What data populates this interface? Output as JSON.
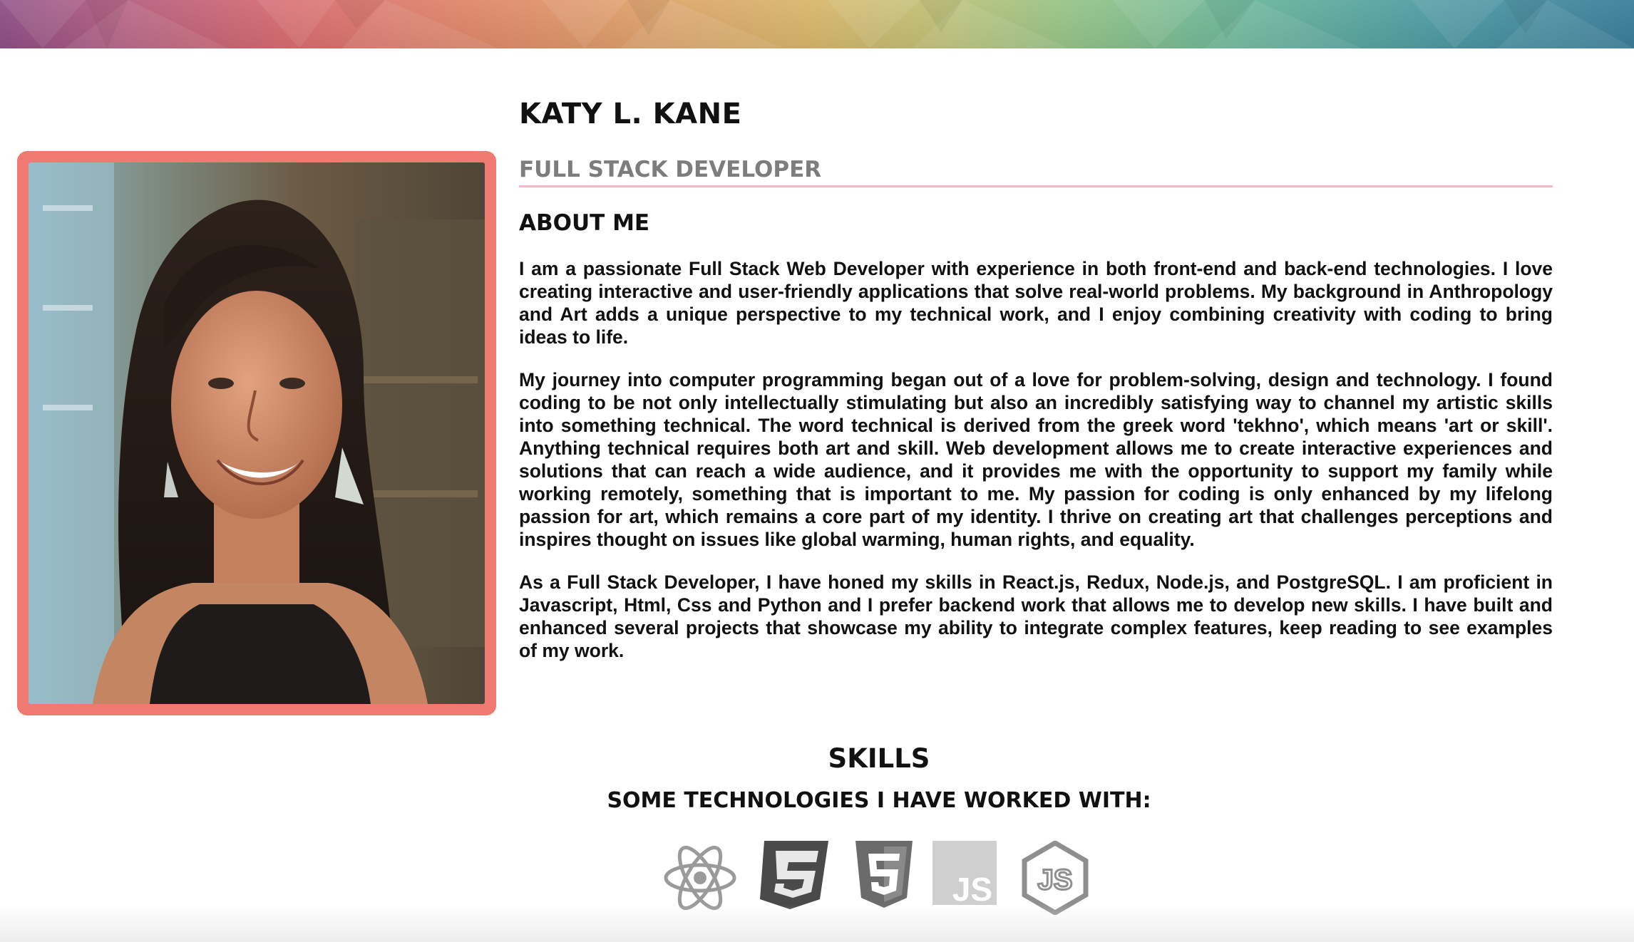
{
  "colors": {
    "frame": "#f07a72",
    "role_underline": "#f4b7c3",
    "role_text": "#7d7d7d",
    "icon_gray": "#8c8c8c"
  },
  "profile": {
    "name": "KATY L. KANE",
    "role": "FULL STACK DEVELOPER",
    "photo_alt": "Katy L. Kane"
  },
  "about": {
    "title": "ABOUT ME",
    "paragraphs": [
      "I am a passionate Full Stack Web Developer with experience in both front-end and back-end technologies. I love creating interactive and user-friendly applications that solve real-world problems. My background in Anthropology and Art adds a unique perspective to my technical work, and I enjoy combining creativity with coding to bring ideas to life.",
      "My journey into computer programming began out of a love for problem-solving, design and technology. I found coding to be not only intellectually stimulating but also an incredibly satisfying way to channel my artistic skills into something technical. The word technical is derived from the greek word 'tekhno', which means 'art or skill'. Anything technical requires both art and skill. Web development allows me to create interactive experiences and solutions that can reach a wide audience, and it provides me with the opportunity to support my family while working remotely, something that is important to me. My passion for coding is only enhanced by my lifelong passion for art, which remains a core part of my identity. I thrive on creating art that challenges perceptions and inspires thought on issues like global warming, human rights, and equality.",
      "As a Full Stack Developer, I have honed my skills in React.js, Redux, Node.js, and PostgreSQL. I am proficient in Javascript, Html, Css and Python and I prefer backend work that allows me to develop new skills. I have built and enhanced several projects that showcase my ability to integrate complex features, keep reading to see examples of my work."
    ]
  },
  "skills": {
    "title": "SKILLS",
    "subtitle": "SOME TECHNOLOGIES I HAVE WORKED WITH:",
    "technologies": [
      {
        "icon": "react-icon"
      },
      {
        "icon": "css3-icon"
      },
      {
        "icon": "html5-icon"
      },
      {
        "icon": "javascript-icon",
        "label": "JS"
      },
      {
        "icon": "nodejs-icon",
        "label": "JS"
      }
    ]
  }
}
